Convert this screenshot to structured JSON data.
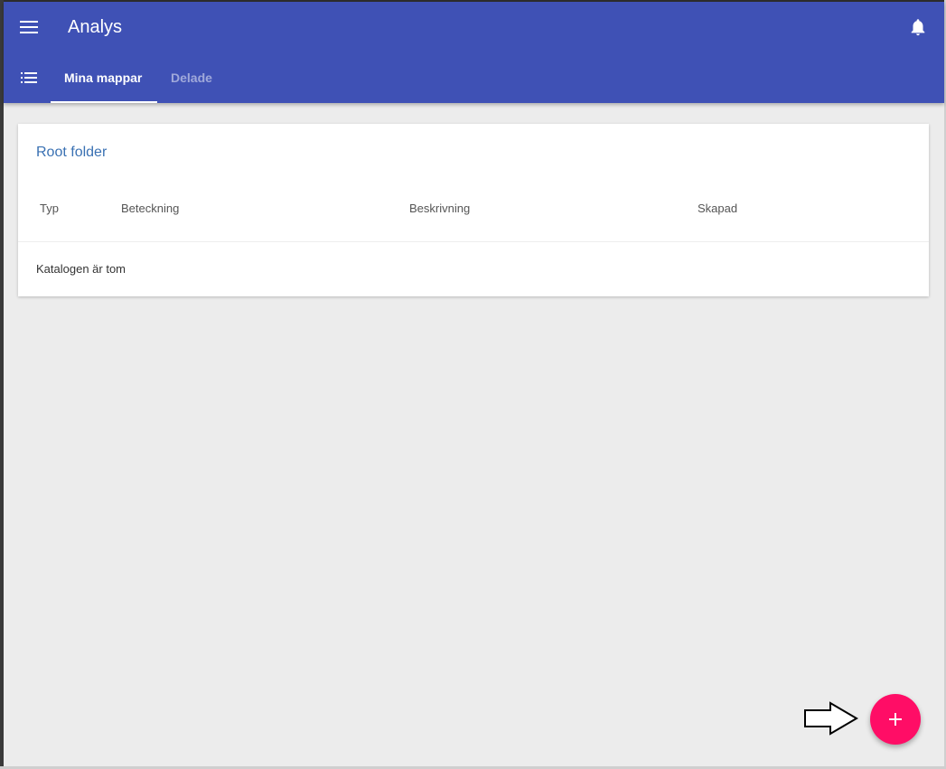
{
  "header": {
    "title": "Analys",
    "menu_icon": "menu-icon",
    "notification_icon": "bell-icon",
    "background_color": "#3f51b5"
  },
  "tabs": {
    "list_icon": "list-icon",
    "items": [
      {
        "label": "Mina mappar",
        "active": true
      },
      {
        "label": "Delade",
        "active": false
      }
    ]
  },
  "folder": {
    "title": "Root folder",
    "columns": [
      "Typ",
      "Beteckning",
      "Beskrivning",
      "Skapad"
    ],
    "empty_message": "Katalogen är tom"
  },
  "fab": {
    "icon": "plus-icon",
    "color": "#ff0d66"
  },
  "annotation": {
    "icon": "arrow-right-icon"
  }
}
